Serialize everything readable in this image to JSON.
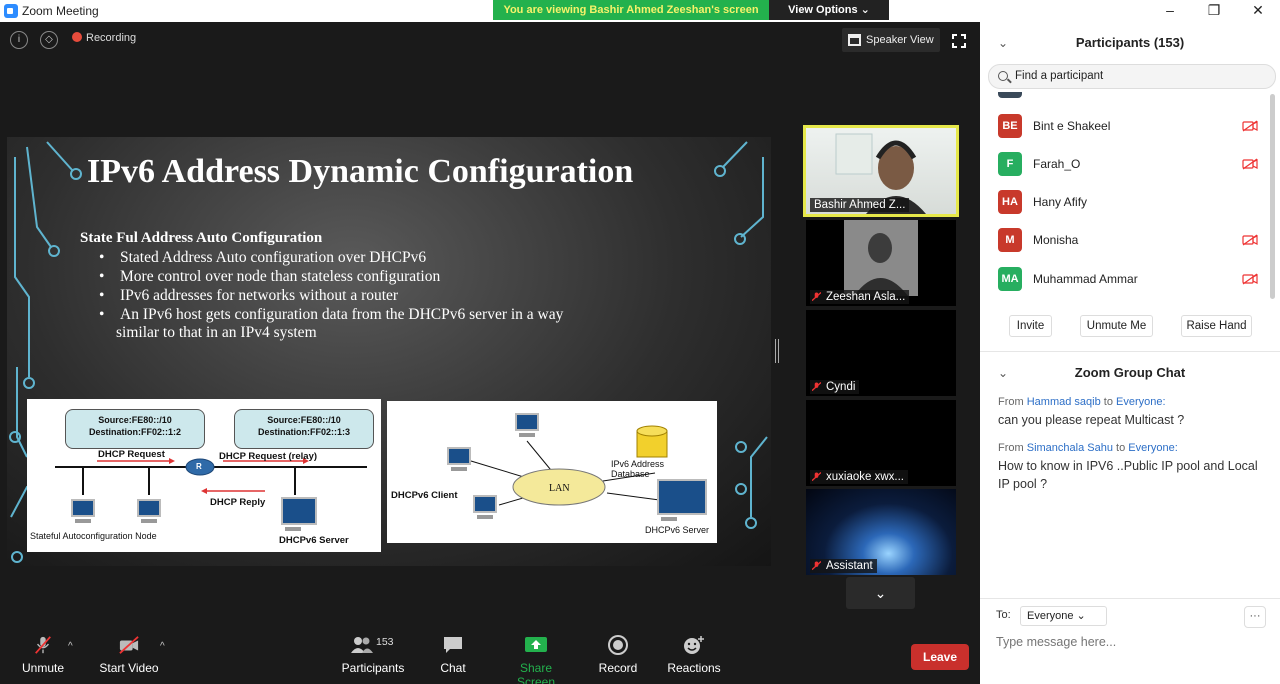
{
  "window": {
    "title": "Zoom Meeting",
    "minimize": "–",
    "restore": "❐",
    "close": "✕"
  },
  "banner": {
    "viewing": "You are viewing Bashir Ahmed Zeeshan's screen",
    "view_options": "View Options ⌄"
  },
  "meeting": {
    "info_icon": "i",
    "shield_icon": "◇",
    "recording_label": "Recording",
    "speaker_view_label": "Speaker View"
  },
  "slide": {
    "title": "IPv6 Address Dynamic Configuration",
    "subtitle": "State Ful Address Auto Configuration",
    "bullets": [
      "Stated Address Auto configuration over DHCPv6",
      "More control over node than stateless configuration",
      "IPv6 addresses for networks without a router",
      "An IPv6 host gets configuration data from the DHCPv6 server in a way"
    ],
    "bullet_continuation": "similar to that in an IPv4 system",
    "diagram1": {
      "box1": [
        "Source:FE80::/10",
        "Destination:FF02::1:2"
      ],
      "box2": [
        "Source:FE80::/10",
        "Destination:FF02::1:3"
      ],
      "request": "DHCP Request",
      "request_relay": "DHCP Request (relay)",
      "router_label": "R",
      "reply": "DHCP Reply",
      "node": "Stateful Autoconfiguration Node",
      "server": "DHCPv6 Server"
    },
    "diagram2": {
      "client": "DHCPv6  Client",
      "lan": "LAN",
      "database": [
        "IPv6 Address",
        "Database"
      ],
      "server": "DHCPv6 Server"
    }
  },
  "thumbnails": [
    {
      "name": "Bashir Ahmed Z...",
      "muted": false,
      "active": true
    },
    {
      "name": "Zeeshan Asla...",
      "muted": true
    },
    {
      "name": "Cyndi",
      "muted": true
    },
    {
      "name": "xuxiaoke xwx...",
      "muted": true
    },
    {
      "name": "Assistant",
      "muted": true
    }
  ],
  "thumb_scroll_icon": "⌄",
  "toolbar": {
    "unmute": "Unmute",
    "start_video": "Start Video",
    "participants": "Participants",
    "participants_count": "153",
    "chat": "Chat",
    "share_screen": "Share Screen",
    "record": "Record",
    "reactions": "Reactions",
    "leave": "Leave",
    "caret": "^"
  },
  "panel": {
    "participants_title": "Participants (153)",
    "collapse_icon": "⌄",
    "search_placeholder": "Find a participant",
    "participants": [
      {
        "initials": "BE",
        "name": "Bint e Shakeel",
        "color": "#c8392b",
        "video_off": true
      },
      {
        "initials": "F",
        "name": "Farah_O",
        "color": "#27ae60",
        "video_off": true
      },
      {
        "initials": "HA",
        "name": "Hany Afify",
        "color": "#c8392b",
        "video_off": false
      },
      {
        "initials": "M",
        "name": "Monisha",
        "color": "#c8392b",
        "video_off": true
      },
      {
        "initials": "MA",
        "name": "Muhammad Ammar",
        "color": "#27ae60",
        "video_off": true
      }
    ],
    "invite": "Invite",
    "unmute_me": "Unmute Me",
    "raise_hand": "Raise Hand",
    "chat_title": "Zoom Group Chat",
    "messages": [
      {
        "from_label": "From",
        "sender": "Hammad saqib",
        "to_label": "to",
        "recipient": "Everyone:",
        "text": "can you please repeat Multicast ?"
      },
      {
        "from_label": "From",
        "sender": "Simanchala Sahu",
        "to_label": "to",
        "recipient": "Everyone:",
        "text": "How to know in IPV6 ..Public IP pool and Local IP pool ?"
      }
    ],
    "to_label": "To:",
    "to_value": "Everyone ⌄",
    "more_icon": "···",
    "message_placeholder": "Type message here..."
  },
  "colors": {
    "banner_green": "#23b14d",
    "banner_text": "#f6f26a",
    "leave_red": "#c9302c",
    "share_green": "#23b14d",
    "active_border": "#e6e84a",
    "link_blue": "#2d6fc7"
  }
}
